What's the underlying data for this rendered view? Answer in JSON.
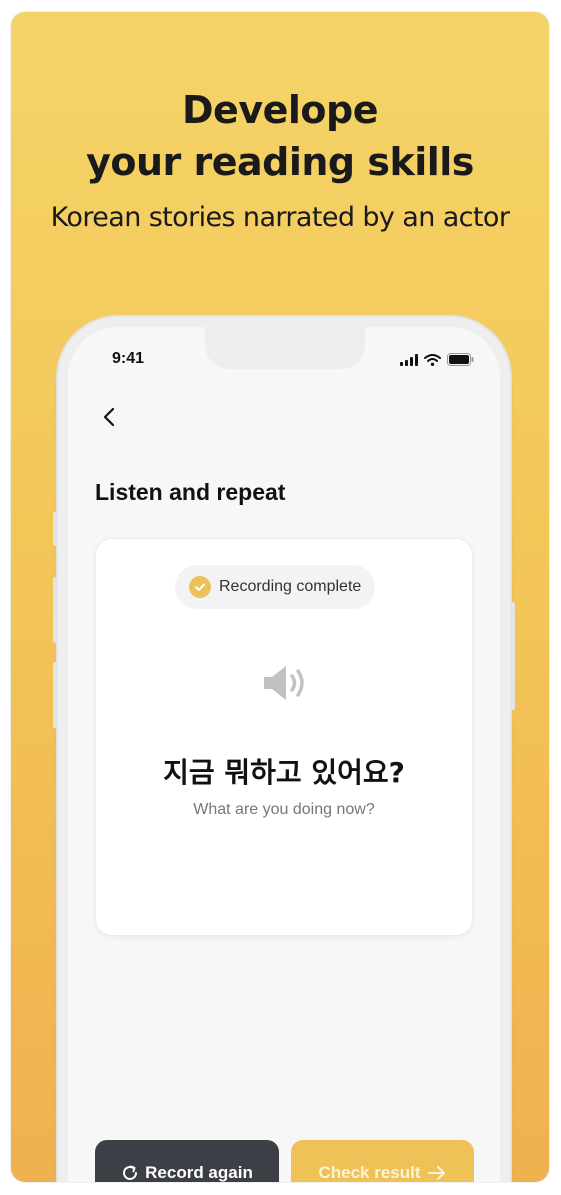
{
  "promo": {
    "headline_line1": "Develope",
    "headline_line2": "your reading skills",
    "subheadline": "Korean stories narrated by an actor"
  },
  "status_bar": {
    "time": "9:41",
    "icons": [
      "signal-icon",
      "wifi-icon",
      "battery-icon"
    ]
  },
  "nav": {
    "back_icon": "chevron-left-icon"
  },
  "page": {
    "title": "Listen and repeat"
  },
  "card": {
    "badge_label": "Recording complete",
    "badge_icon": "check-circle-icon",
    "speaker_icon": "speaker-icon",
    "korean_text": "지금 뭐하고 있어요?",
    "english_text": "What are you doing now?"
  },
  "actions": {
    "record_again_label": "Record again",
    "record_again_icon": "refresh-icon",
    "check_result_label": "Check result",
    "check_result_icon": "arrow-right-icon"
  },
  "colors": {
    "background_top": "#f4d468",
    "background_bottom": "#f0b14f",
    "accent": "#ecc157",
    "dark_button": "#3d3f46"
  }
}
